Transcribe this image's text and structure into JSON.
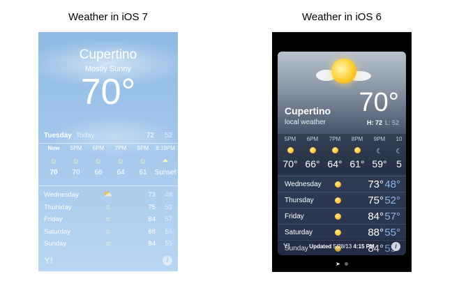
{
  "captions": {
    "left": "Weather in iOS 7",
    "right": "Weather in iOS 6"
  },
  "ios7": {
    "city": "Cupertino",
    "condition": "Mostly Sunny",
    "temp": "70°",
    "today": {
      "day": "Tuesday",
      "label": "Today",
      "hi": "72",
      "lo": "52"
    },
    "hourly": [
      {
        "time": "Now",
        "icon": "sun-icon",
        "temp": "70"
      },
      {
        "time": "5PM",
        "icon": "sun-icon",
        "temp": "70"
      },
      {
        "time": "6PM",
        "icon": "sun-icon",
        "temp": "66"
      },
      {
        "time": "7PM",
        "icon": "sun-icon",
        "temp": "64"
      },
      {
        "time": "8PM",
        "icon": "sun-icon",
        "temp": "61"
      },
      {
        "time": "8:19PM",
        "icon": "sunset-icon",
        "temp": "Sunset"
      }
    ],
    "forecast": [
      {
        "day": "Wednesday",
        "icon": "partly-cloudy-icon",
        "hi": "73",
        "lo": "48"
      },
      {
        "day": "Thursday",
        "icon": "sun-icon",
        "hi": "75",
        "lo": "52"
      },
      {
        "day": "Friday",
        "icon": "sun-icon",
        "hi": "84",
        "lo": "57"
      },
      {
        "day": "Saturday",
        "icon": "sun-icon",
        "hi": "88",
        "lo": "55"
      },
      {
        "day": "Sunday",
        "icon": "sun-icon",
        "hi": "84",
        "lo": "55"
      }
    ],
    "yahoo": "Y!",
    "info": "i"
  },
  "ios6": {
    "city": "Cupertino",
    "subtitle": "local weather",
    "temp": "70°",
    "hi_label": "H: 72",
    "lo_label": "L: 52",
    "hourly": [
      {
        "time": "5PM",
        "icon": "sun-icon",
        "temp": "70°"
      },
      {
        "time": "6PM",
        "icon": "sun-icon",
        "temp": "66°"
      },
      {
        "time": "7PM",
        "icon": "sun-icon",
        "temp": "64°"
      },
      {
        "time": "8PM",
        "icon": "sun-icon",
        "temp": "61°"
      },
      {
        "time": "9PM",
        "icon": "moon-icon",
        "temp": "59°"
      },
      {
        "time": "10",
        "icon": "moon-icon",
        "temp": "5"
      }
    ],
    "forecast": [
      {
        "day": "Wednesday",
        "icon": "partly-cloudy-icon",
        "hi": "73°",
        "lo": "48°"
      },
      {
        "day": "Thursday",
        "icon": "sun-icon",
        "hi": "75°",
        "lo": "52°"
      },
      {
        "day": "Friday",
        "icon": "sun-icon",
        "hi": "84°",
        "lo": "57°"
      },
      {
        "day": "Saturday",
        "icon": "sun-icon",
        "hi": "88°",
        "lo": "55°"
      },
      {
        "day": "Sunday",
        "icon": "sun-icon",
        "hi": "84°",
        "lo": "55°"
      }
    ],
    "updated_label": "Updated",
    "updated_date": "5/28/13",
    "updated_time": "4:15 PM",
    "yahoo": "Y!",
    "info": "i"
  }
}
